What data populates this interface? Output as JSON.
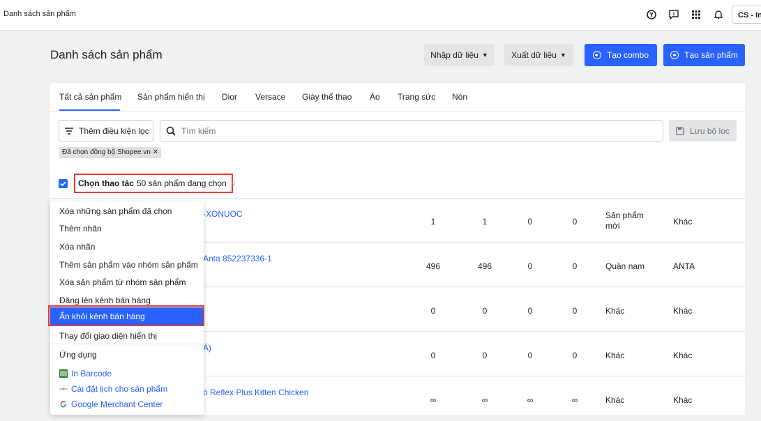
{
  "topbar": {
    "breadcrumb": "Danh sách sản phẩm",
    "icons": [
      "support-icon",
      "chat-icon",
      "apps-grid-icon",
      "bell-icon"
    ],
    "store_label": "CS - Int"
  },
  "header": {
    "title": "Danh sách sản phẩm",
    "import_label": "Nhập dữ liệu",
    "export_label": "Xuất dữ liệu",
    "create_combo_label": "Tạo combo",
    "create_product_label": "Tạo sản phẩm"
  },
  "tabs": [
    {
      "label": "Tất cả sản phẩm",
      "active": true
    },
    {
      "label": "Sản phẩm hiển thị"
    },
    {
      "label": "Dior"
    },
    {
      "label": "Versace"
    },
    {
      "label": "Giày thể thao"
    },
    {
      "label": "Áo"
    },
    {
      "label": "Trang sức"
    },
    {
      "label": "Nón"
    }
  ],
  "filters": {
    "add_filter_label": "Thêm điều kiện lọc",
    "search_placeholder": "Tìm kiếm",
    "save_filter_label": "Lưu bộ lọc",
    "active_chip": "Đã chọn đồng bộ Shopee.vn"
  },
  "bulk": {
    "action_label": "Chọn thao tác",
    "selected_text": "50 sản phẩm đang chọn"
  },
  "rows": [
    {
      "name_fragment": "-XONUOC",
      "c1": "1",
      "c2": "1",
      "c3": "0",
      "c4": "0",
      "type_line1": "Sản phẩm",
      "type_line2": "mới",
      "brand": "Khác"
    },
    {
      "name_fragment": "Anta 852237336-1",
      "c1": "496",
      "c2": "496",
      "c3": "0",
      "c4": "0",
      "type_line1": "Quần nam",
      "type_line2": "",
      "brand": "ANTA"
    },
    {
      "name_fragment": "",
      "c1": "0",
      "c2": "0",
      "c3": "0",
      "c4": "0",
      "type_line1": "Khác",
      "type_line2": "",
      "brand": "Khác"
    },
    {
      "name_fragment": "Á)",
      "c1": "0",
      "c2": "0",
      "c3": "0",
      "c4": "0",
      "type_line1": "Khác",
      "type_line2": "",
      "brand": "Khác"
    },
    {
      "name_fragment": "ó Reflex Plus Kitten Chicken",
      "c1": "∞",
      "c2": "∞",
      "c3": "∞",
      "c4": "∞",
      "type_line1": "Khác",
      "type_line2": "",
      "brand": "Khác"
    }
  ],
  "menu": {
    "items": [
      "Xóa những sản phẩm đã chọn",
      "Thêm nhãn",
      "Xóa nhãn",
      "Thêm sản phẩm vào nhóm sản phẩm",
      "Xóa sản phẩm từ nhóm sản phẩm",
      "Đăng lên kênh bán hàng",
      "Ẩn khỏi kênh bán hàng",
      "Thay đổi giao diện hiển thị"
    ],
    "highlighted": "Ẩn khỏi kênh bán hàng",
    "apps_header": "Ứng dụng",
    "apps": [
      {
        "label": "In Barcode",
        "icon": "barcode-icon"
      },
      {
        "label": "Cài đặt lịch cho sản phẩm",
        "icon": "schedule-icon"
      },
      {
        "label": "Google Merchant Center",
        "icon": "google-icon"
      }
    ]
  },
  "colors": {
    "accent": "#2962ff",
    "highlight_border": "#e53935"
  }
}
